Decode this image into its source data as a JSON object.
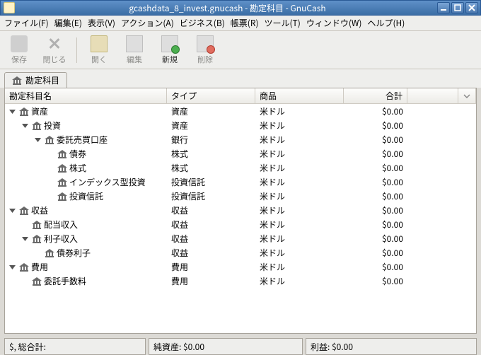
{
  "titlebar": {
    "title": "gcashdata_8_invest.gnucash - 勘定科目 - GnuCash"
  },
  "menu": {
    "file": "ファイル(F)",
    "edit": "編集(E)",
    "view": "表示(V)",
    "actions": "アクション(A)",
    "business": "ビジネス(B)",
    "reports": "帳票(R)",
    "tools": "ツール(T)",
    "windows": "ウィンドウ(W)",
    "help": "ヘルプ(H)"
  },
  "toolbar": {
    "save": "保存",
    "close": "閉じる",
    "open": "開く",
    "edit": "編集",
    "new": "新規",
    "delete": "削除"
  },
  "tab": {
    "label": "勘定科目"
  },
  "columns": {
    "name": "勘定科目名",
    "type": "タイプ",
    "product": "商品",
    "total": "合計"
  },
  "tree": [
    {
      "depth": 0,
      "exp": "open",
      "name": "資産",
      "type": "資産",
      "product": "米ドル",
      "total": "$0.00"
    },
    {
      "depth": 1,
      "exp": "open",
      "name": "投資",
      "type": "資産",
      "product": "米ドル",
      "total": "$0.00"
    },
    {
      "depth": 2,
      "exp": "open",
      "name": "委託売買口座",
      "type": "銀行",
      "product": "米ドル",
      "total": "$0.00"
    },
    {
      "depth": 3,
      "exp": "none",
      "name": "債券",
      "type": "株式",
      "product": "米ドル",
      "total": "$0.00"
    },
    {
      "depth": 3,
      "exp": "none",
      "name": "株式",
      "type": "株式",
      "product": "米ドル",
      "total": "$0.00"
    },
    {
      "depth": 3,
      "exp": "none",
      "name": "インデックス型投資",
      "type": "投資信託",
      "product": "米ドル",
      "total": "$0.00"
    },
    {
      "depth": 3,
      "exp": "none",
      "name": "投資信託",
      "type": "投資信託",
      "product": "米ドル",
      "total": "$0.00"
    },
    {
      "depth": 0,
      "exp": "open",
      "name": "収益",
      "type": "収益",
      "product": "米ドル",
      "total": "$0.00"
    },
    {
      "depth": 1,
      "exp": "none",
      "name": "配当収入",
      "type": "収益",
      "product": "米ドル",
      "total": "$0.00"
    },
    {
      "depth": 1,
      "exp": "open",
      "name": "利子収入",
      "type": "収益",
      "product": "米ドル",
      "total": "$0.00"
    },
    {
      "depth": 2,
      "exp": "none",
      "name": "債券利子",
      "type": "収益",
      "product": "米ドル",
      "total": "$0.00"
    },
    {
      "depth": 0,
      "exp": "open",
      "name": "費用",
      "type": "費用",
      "product": "米ドル",
      "total": "$0.00"
    },
    {
      "depth": 1,
      "exp": "none",
      "name": "委託手数料",
      "type": "費用",
      "product": "米ドル",
      "total": "$0.00"
    }
  ],
  "status": {
    "currency": "$, 総合計:",
    "net": "純資産: $0.00",
    "profit": "利益: $0.00"
  }
}
